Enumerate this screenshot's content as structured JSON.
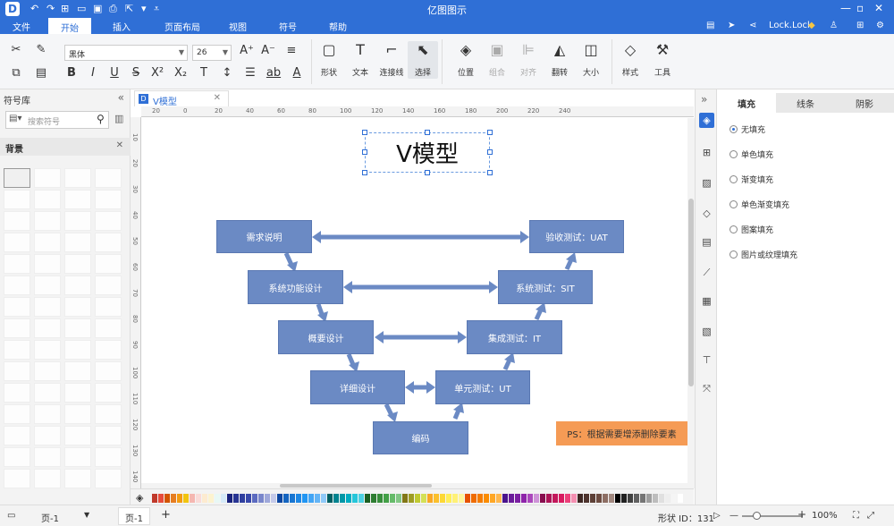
{
  "titlebar": {
    "app_title": "亿图图示",
    "logo": "D"
  },
  "menubar": {
    "items": [
      "文件",
      "开始",
      "插入",
      "页面布局",
      "视图",
      "符号",
      "帮助"
    ],
    "active": "开始",
    "user": "Lock.Lock"
  },
  "ribbon": {
    "font_name": "黑体",
    "font_size": "26",
    "tools": {
      "shape": "形状",
      "text": "文本",
      "connector": "连接线",
      "select": "选择",
      "position": "位置",
      "group": "组合",
      "align": "对齐",
      "flip": "翻转",
      "size": "大小",
      "style": "样式",
      "tool": "工具"
    }
  },
  "left_panel": {
    "title": "符号库",
    "search_placeholder": "搜索符号",
    "section": "背景"
  },
  "document": {
    "tab_title": "V模型",
    "diagram_title": "V模型",
    "boxes": {
      "req": "需求说明",
      "func": "系统功能设计",
      "outline": "概要设计",
      "detail": "详细设计",
      "code": "编码",
      "unit": "单元测试：UT",
      "integ": "集成测试：IT",
      "sys": "系统测试：SIT",
      "uat": "验收测试：UAT"
    },
    "note": "PS：根据需要增添删除要素"
  },
  "rulers": {
    "h_ticks": [
      "20",
      "0",
      "20",
      "40",
      "60",
      "80",
      "100",
      "120",
      "140",
      "160",
      "180",
      "200",
      "220",
      "240"
    ],
    "v_ticks": [
      "10",
      "20",
      "30",
      "40",
      "50",
      "60",
      "70",
      "80",
      "90",
      "100",
      "110",
      "120",
      "130",
      "140"
    ]
  },
  "right_panel": {
    "tabs": [
      "填充",
      "线条",
      "阴影"
    ],
    "active_tab": "填充",
    "fill_options": [
      "无填充",
      "单色填充",
      "渐变填充",
      "单色渐变填充",
      "图案填充",
      "图片或纹理填充"
    ],
    "selected_option": "无填充"
  },
  "statusbar": {
    "page_left": "页-1",
    "page_tab": "页-1",
    "add": "+",
    "shape_id": "形状 ID：131",
    "zoom": "100%"
  },
  "palette_colors": [
    "#c0392b",
    "#e74c3c",
    "#d35400",
    "#e67e22",
    "#f39c12",
    "#f1c40f",
    "#f5b7b1",
    "#fadbd8",
    "#fdebd0",
    "#fcf3cf",
    "#e8f8f5",
    "#d6eaf8",
    "#1a237e",
    "#283593",
    "#303f9f",
    "#3949ab",
    "#5c6bc0",
    "#7986cb",
    "#9fa8da",
    "#c5cae9",
    "#0d47a1",
    "#1565c0",
    "#1976d2",
    "#1e88e5",
    "#2196f3",
    "#42a5f5",
    "#64b5f6",
    "#90caf9",
    "#006064",
    "#00838f",
    "#0097a7",
    "#00acc1",
    "#26c6da",
    "#4dd0e1",
    "#1b5e20",
    "#2e7d32",
    "#388e3c",
    "#43a047",
    "#66bb6a",
    "#81c784",
    "#827717",
    "#9e9d24",
    "#c0ca33",
    "#d4e157",
    "#f9a825",
    "#fbc02d",
    "#fdd835",
    "#ffee58",
    "#fff176",
    "#fff59d",
    "#e65100",
    "#ef6c00",
    "#f57c00",
    "#fb8c00",
    "#ffa726",
    "#ffb74d",
    "#4a148c",
    "#6a1b9a",
    "#7b1fa2",
    "#8e24aa",
    "#ab47bc",
    "#ce93d8",
    "#880e4f",
    "#ad1457",
    "#c2185b",
    "#d81b60",
    "#ec407a",
    "#f48fb1",
    "#3e2723",
    "#4e342e",
    "#5d4037",
    "#6d4c41",
    "#8d6e63",
    "#a1887f",
    "#000000",
    "#212121",
    "#424242",
    "#616161",
    "#757575",
    "#9e9e9e",
    "#bdbdbd",
    "#e0e0e0",
    "#eeeeee",
    "#f5f5f5",
    "#ffffff"
  ],
  "accent_color": "#2f6fd6",
  "box_color": "#6b8ac4",
  "note_color": "#f59b55"
}
